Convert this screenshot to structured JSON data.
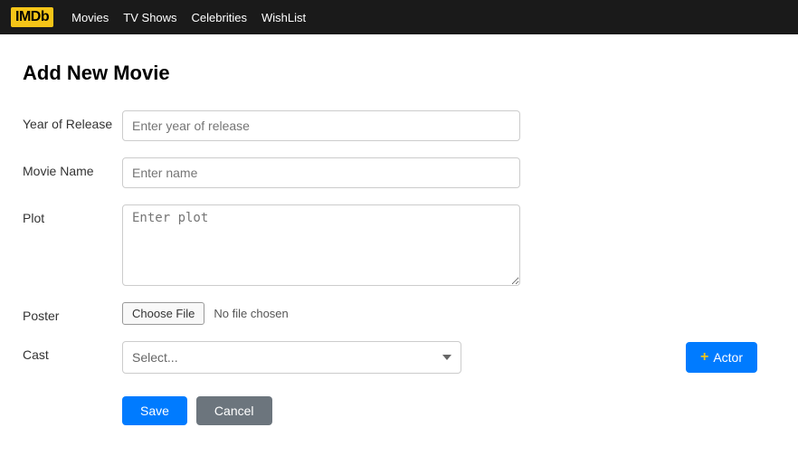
{
  "navbar": {
    "logo": "IMDb",
    "links": [
      "Movies",
      "TV Shows",
      "Celebrities",
      "WishList"
    ]
  },
  "form": {
    "page_title": "Add New Movie",
    "year_of_release": {
      "label": "Year of Release",
      "placeholder": "Enter year of release",
      "value": ""
    },
    "movie_name": {
      "label": "Movie Name",
      "placeholder": "Enter name",
      "value": ""
    },
    "plot": {
      "label": "Plot",
      "placeholder": "Enter plot",
      "value": ""
    },
    "poster": {
      "label": "Poster",
      "choose_file_label": "Choose File",
      "no_file_text": "No file chosen"
    },
    "cast": {
      "label": "Cast",
      "select_placeholder": "Select...",
      "options": []
    },
    "add_actor_button": "+ Actor",
    "add_actor_plus": "+",
    "add_actor_text": "Actor",
    "save_button": "Save",
    "cancel_button": "Cancel"
  }
}
